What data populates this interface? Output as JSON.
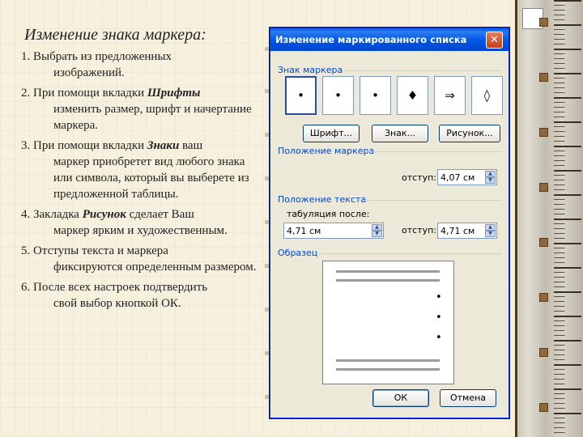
{
  "slide": {
    "title": "Изменение знака маркера:",
    "steps": [
      {
        "lead": "1. Выбрать из предложенных",
        "rest": "изображений."
      },
      {
        "lead": "2. При помощи вкладки ",
        "bold": "Шрифты",
        "rest": "изменить размер, шрифт и начертание маркера."
      },
      {
        "lead": "3. При помощи вкладки ",
        "bold": "Знаки",
        "after": " ваш",
        "rest": "маркер приобретет вид любого знака или символа, который вы выберете из предложенной таблицы."
      },
      {
        "lead": "4. Закладка ",
        "bold": "Рисунок",
        "after": " сделает Ваш",
        "rest": "маркер ярким и художественным."
      },
      {
        "lead": "5. Отступы текста и маркера",
        "rest": "фиксируются определенным размером."
      },
      {
        "lead": "6. После всех настроек подтвердить",
        "rest": "свой выбор кнопкой ОК."
      }
    ]
  },
  "dialog": {
    "title": "Изменение маркированного списка",
    "close_icon": "close-icon",
    "marker_group_label": "Знак маркера",
    "markers": [
      "•",
      "•",
      "•",
      "♦",
      "⇒",
      "◊"
    ],
    "selected_marker_index": 0,
    "buttons": {
      "font": "Шрифт...",
      "char": "Знак...",
      "picture": "Рисунок...",
      "ok": "ОК",
      "cancel": "Отмена"
    },
    "marker_position_label": "Положение маркера",
    "indent_label": "отступ:",
    "marker_indent_value": "4,07 см",
    "text_position_label": "Положение текста",
    "tab_after_label": "табуляция после:",
    "tab_after_value": "4,71 см",
    "text_indent_label": "отступ:",
    "text_indent_value": "4,71 см",
    "sample_label": "Образец",
    "preview_bullet": "•",
    "colors": {
      "titlebar": "#0055e5",
      "group_label": "#0046d5",
      "dialog_bg": "#ece9d8"
    }
  }
}
